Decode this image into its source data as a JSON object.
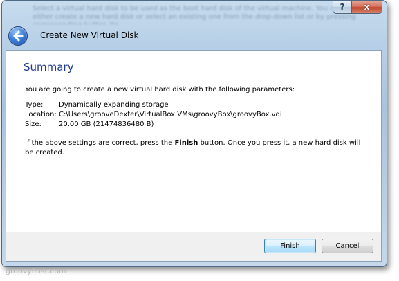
{
  "window": {
    "title": "Create New Virtual Disk",
    "background_text": "Select a virtual hard disk to be used as the boot hard disk of the virtual machine. You can either create a new hard disk or select an existing one from the drop-down list or by pressing corresponding button (to",
    "help_label": "?",
    "close_label": "x"
  },
  "summary": {
    "heading": "Summary",
    "intro": "You are going to create a new virtual hard disk with the following parameters:",
    "params": [
      {
        "label": "Type:",
        "value": "Dynamically expanding storage"
      },
      {
        "label": "Location:",
        "value": "C:\\Users\\grooveDexter\\VirtualBox VMs\\groovyBox\\groovyBox.vdi"
      },
      {
        "label": "Size:",
        "value": "20.00 GB (21474836480 B)"
      }
    ],
    "outro_before": "If the above settings are correct, press the ",
    "outro_bold": "Finish",
    "outro_after": " button. Once you press it, a new hard disk will be created."
  },
  "buttons": {
    "finish": "Finish",
    "cancel": "Cancel"
  },
  "watermark": "groovyPost.com",
  "colors": {
    "heading": "#1e3a8c",
    "accent_blue": "#3f80d8",
    "close_red": "#c2462d"
  }
}
